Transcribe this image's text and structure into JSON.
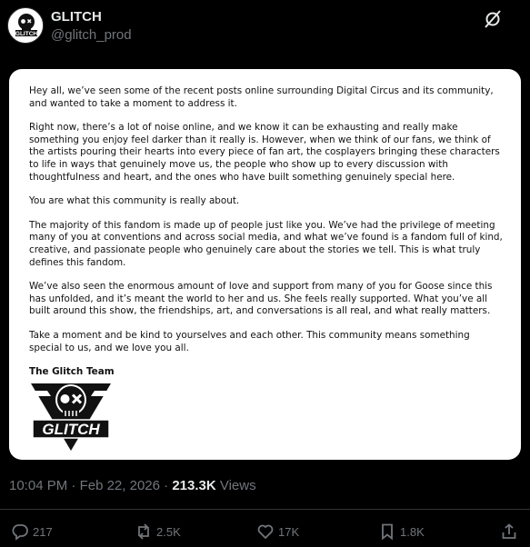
{
  "post": {
    "display_name": "GLITCH",
    "handle": "@glitch_prod",
    "avatar_icon": "glitch-skull-logo",
    "grok_icon": "grok-icon"
  },
  "letter": {
    "paragraphs": [
      "Hey all, we’ve seen some of the recent posts online surrounding Digital Circus and its community, and wanted to take a moment to address it.",
      "Right now, there’s a lot of noise online, and we know it can be exhausting and really make something you enjoy feel darker than it really is. However, when we think of our fans, we think of the artists pouring their hearts into every piece of fan art, the cosplayers bringing these characters to life in ways that genuinely move us, the people who show up to every discussion with thoughtfulness and heart, and the ones who have built something genuinely special here.",
      "You are what this community is really about.",
      "The majority of this fandom is made up of people just like you. We’ve had the privilege of meeting many of you at conventions and across social media, and what we’ve found is a fandom full of kind, creative, and passionate people who genuinely care about the stories we tell. This is what truly defines this fandom.",
      "We’ve also seen the enormous amount of love and support from many of you for Goose since this has unfolded, and it’s meant the world to her and us. She feels really supported. What you’ve all built around this show, the friendships, art, and conversations is all real, and what really matters.",
      "Take a moment and be kind to yourselves and each other. This community means something special to us, and we love you all."
    ],
    "signature": "The Glitch Team",
    "logo_text": "GLITCH"
  },
  "meta": {
    "time": "10:04 PM",
    "separator": " · ",
    "date": "Feb 22, 2026",
    "views_count": "213.3K",
    "views_label": " Views"
  },
  "actions": {
    "replies": "217",
    "reposts": "2.5K",
    "likes": "17K",
    "bookmarks": "1.8K"
  }
}
